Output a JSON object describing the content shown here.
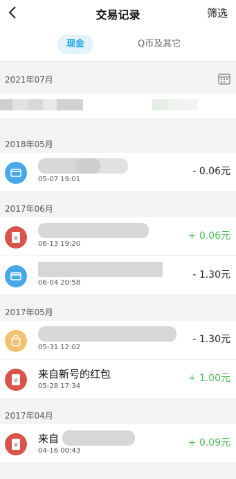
{
  "header": {
    "title": "交易记录",
    "filter_label": "筛选"
  },
  "tabs": {
    "cash_label": "现金",
    "other_label": "Q币及其它"
  },
  "sections": {
    "s2021_07": "2021年07月",
    "s2018_05": "2018年05月",
    "s2017_06": "2017年06月",
    "s2017_05": "2017年05月",
    "s2017_04": "2017年04月"
  },
  "rows": [
    {
      "name": "",
      "time": "05-07 19:01",
      "amount": "- 0.06元",
      "icon": "card-icon"
    },
    {
      "name": "",
      "time": "06-13 19:20",
      "amount": "+ 0.06元",
      "icon": "red-packet-icon"
    },
    {
      "name": "",
      "time": "06-04 20:58",
      "amount": "- 1.30元",
      "icon": "card-icon"
    },
    {
      "name": "",
      "time": "05-31 12:02",
      "amount": "- 1.30元",
      "icon": "shopping-bag-icon"
    },
    {
      "name": "来自新号的红包",
      "time": "05-28 17:34",
      "amount": "+ 1.00元",
      "icon": "red-packet-icon"
    },
    {
      "name": "来自",
      "time": "04-16 00:43",
      "amount": "+ 0.09元",
      "icon": "red-packet-icon"
    }
  ],
  "colors": {
    "accent": "#1aa0e6",
    "positive": "#4cbb54",
    "card_icon": "#47a9e8",
    "red_packet_icon": "#d9534b",
    "bag_icon": "#f3c171"
  }
}
